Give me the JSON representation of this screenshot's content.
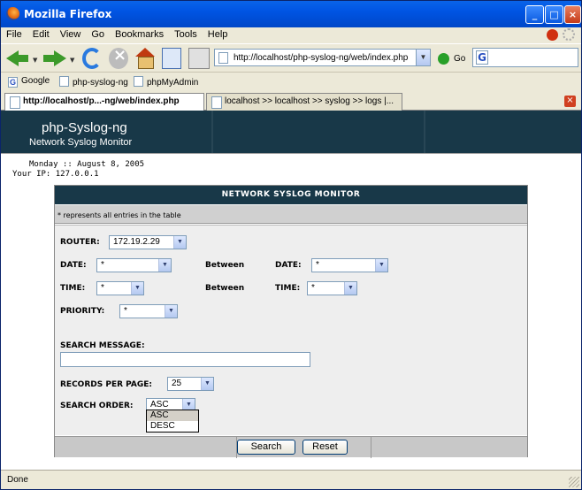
{
  "window": {
    "title": "Mozilla Firefox"
  },
  "menu": {
    "items": [
      {
        "label": "File"
      },
      {
        "label": "Edit"
      },
      {
        "label": "View"
      },
      {
        "label": "Go"
      },
      {
        "label": "Bookmarks"
      },
      {
        "label": "Tools"
      },
      {
        "label": "Help"
      }
    ]
  },
  "toolbar": {
    "url": "http://localhost/php-syslog-ng/web/index.php",
    "go_label": "Go",
    "icons": [
      "back-icon",
      "forward-icon",
      "reload-icon",
      "stop-icon",
      "home-icon",
      "new-tab-icon",
      "bookmark-icon"
    ]
  },
  "bookmarks": [
    {
      "label": "Google"
    },
    {
      "label": "php-syslog-ng"
    },
    {
      "label": "phpMyAdmin"
    }
  ],
  "tabs": [
    {
      "label": "http://localhost/p...-ng/web/index.php",
      "active": true
    },
    {
      "label": "localhost >> localhost >> syslog  >> logs |...",
      "active": false
    }
  ],
  "page": {
    "site_title": "php-Syslog-ng",
    "site_subtitle": "Network Syslog Monitor",
    "date_line": "Monday :: August 8, 2005",
    "ip_line": "Your IP: 127.0.0.1",
    "panel_title": "NETWORK SYSLOG MONITOR",
    "note": "* represents all entries in the table",
    "form": {
      "router_label": "ROUTER:",
      "router_value": "172.19.2.29",
      "date_label": "DATE:",
      "date_value": "*",
      "between1": "Between",
      "date2_label": "DATE:",
      "date2_value": "*",
      "time_label": "TIME:",
      "time_value": "*",
      "between2": "Between",
      "time2_label": "TIME:",
      "time2_value": "*",
      "priority_label": "PRIORITY:",
      "priority_value": "*",
      "search_label": "SEARCH MESSAGE:",
      "search_value": "",
      "records_label": "RECORDS PER PAGE:",
      "records_value": "25",
      "order_label": "SEARCH ORDER:",
      "order_value": "ASC",
      "order_options": [
        "ASC",
        "DESC"
      ],
      "search_button": "Search",
      "reset_button": "Reset"
    }
  },
  "status": {
    "text": "Done"
  }
}
